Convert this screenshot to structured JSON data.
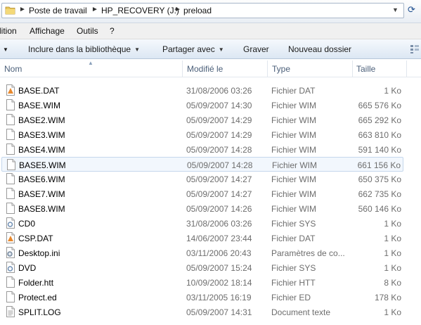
{
  "address_bar": {
    "breadcrumbs": [
      "Poste de travail",
      "HP_RECOVERY (J:)",
      "preload"
    ]
  },
  "menu": {
    "items": [
      "lition",
      "Affichage",
      "Outils",
      "?"
    ]
  },
  "commands": {
    "include_library": "Inclure dans la bibliothèque",
    "share_with": "Partager avec",
    "burn": "Graver",
    "new_folder": "Nouveau dossier"
  },
  "columns": {
    "name": "Nom",
    "modified": "Modifié le",
    "type": "Type",
    "size": "Taille"
  },
  "files": [
    {
      "name": "BASE.DAT",
      "date": "31/08/2006 03:26",
      "type": "Fichier DAT",
      "size": "1 Ko",
      "icon": "dat-file-icon"
    },
    {
      "name": "BASE.WIM",
      "date": "05/09/2007 14:30",
      "type": "Fichier WIM",
      "size": "665 576 Ko",
      "icon": "blank-file-icon"
    },
    {
      "name": "BASE2.WIM",
      "date": "05/09/2007 14:29",
      "type": "Fichier WIM",
      "size": "665 292 Ko",
      "icon": "blank-file-icon"
    },
    {
      "name": "BASE3.WIM",
      "date": "05/09/2007 14:29",
      "type": "Fichier WIM",
      "size": "663 810 Ko",
      "icon": "blank-file-icon"
    },
    {
      "name": "BASE4.WIM",
      "date": "05/09/2007 14:28",
      "type": "Fichier WIM",
      "size": "591 140 Ko",
      "icon": "blank-file-icon"
    },
    {
      "name": "BASE5.WIM",
      "date": "05/09/2007 14:28",
      "type": "Fichier WIM",
      "size": "661 156 Ko",
      "icon": "blank-file-icon",
      "selected": true
    },
    {
      "name": "BASE6.WIM",
      "date": "05/09/2007 14:27",
      "type": "Fichier WIM",
      "size": "650 375 Ko",
      "icon": "blank-file-icon"
    },
    {
      "name": "BASE7.WIM",
      "date": "05/09/2007 14:27",
      "type": "Fichier WIM",
      "size": "662 735 Ko",
      "icon": "blank-file-icon"
    },
    {
      "name": "BASE8.WIM",
      "date": "05/09/2007 14:26",
      "type": "Fichier WIM",
      "size": "560 146 Ko",
      "icon": "blank-file-icon"
    },
    {
      "name": "CD0",
      "date": "31/08/2006 03:26",
      "type": "Fichier SYS",
      "size": "1 Ko",
      "icon": "system-file-icon"
    },
    {
      "name": "CSP.DAT",
      "date": "14/06/2007 23:44",
      "type": "Fichier DAT",
      "size": "1 Ko",
      "icon": "dat-file-icon"
    },
    {
      "name": "Desktop.ini",
      "date": "03/11/2006 20:43",
      "type": "Paramètres de co...",
      "size": "1 Ko",
      "icon": "settings-file-icon"
    },
    {
      "name": "DVD",
      "date": "05/09/2007 15:24",
      "type": "Fichier SYS",
      "size": "1 Ko",
      "icon": "system-file-icon"
    },
    {
      "name": "Folder.htt",
      "date": "10/09/2002 18:14",
      "type": "Fichier HTT",
      "size": "8 Ko",
      "icon": "blank-file-icon"
    },
    {
      "name": "Protect.ed",
      "date": "03/11/2005 16:19",
      "type": "Fichier ED",
      "size": "178 Ko",
      "icon": "blank-file-icon"
    },
    {
      "name": "SPLIT.LOG",
      "date": "05/09/2007 14:31",
      "type": "Document texte",
      "size": "1 Ko",
      "icon": "text-file-icon"
    }
  ],
  "colors": {
    "selection_bg": "#f2f7fd",
    "selection_border": "#c5d7ec",
    "header_text": "#4c607a",
    "meta_text": "#6d6d6d"
  }
}
